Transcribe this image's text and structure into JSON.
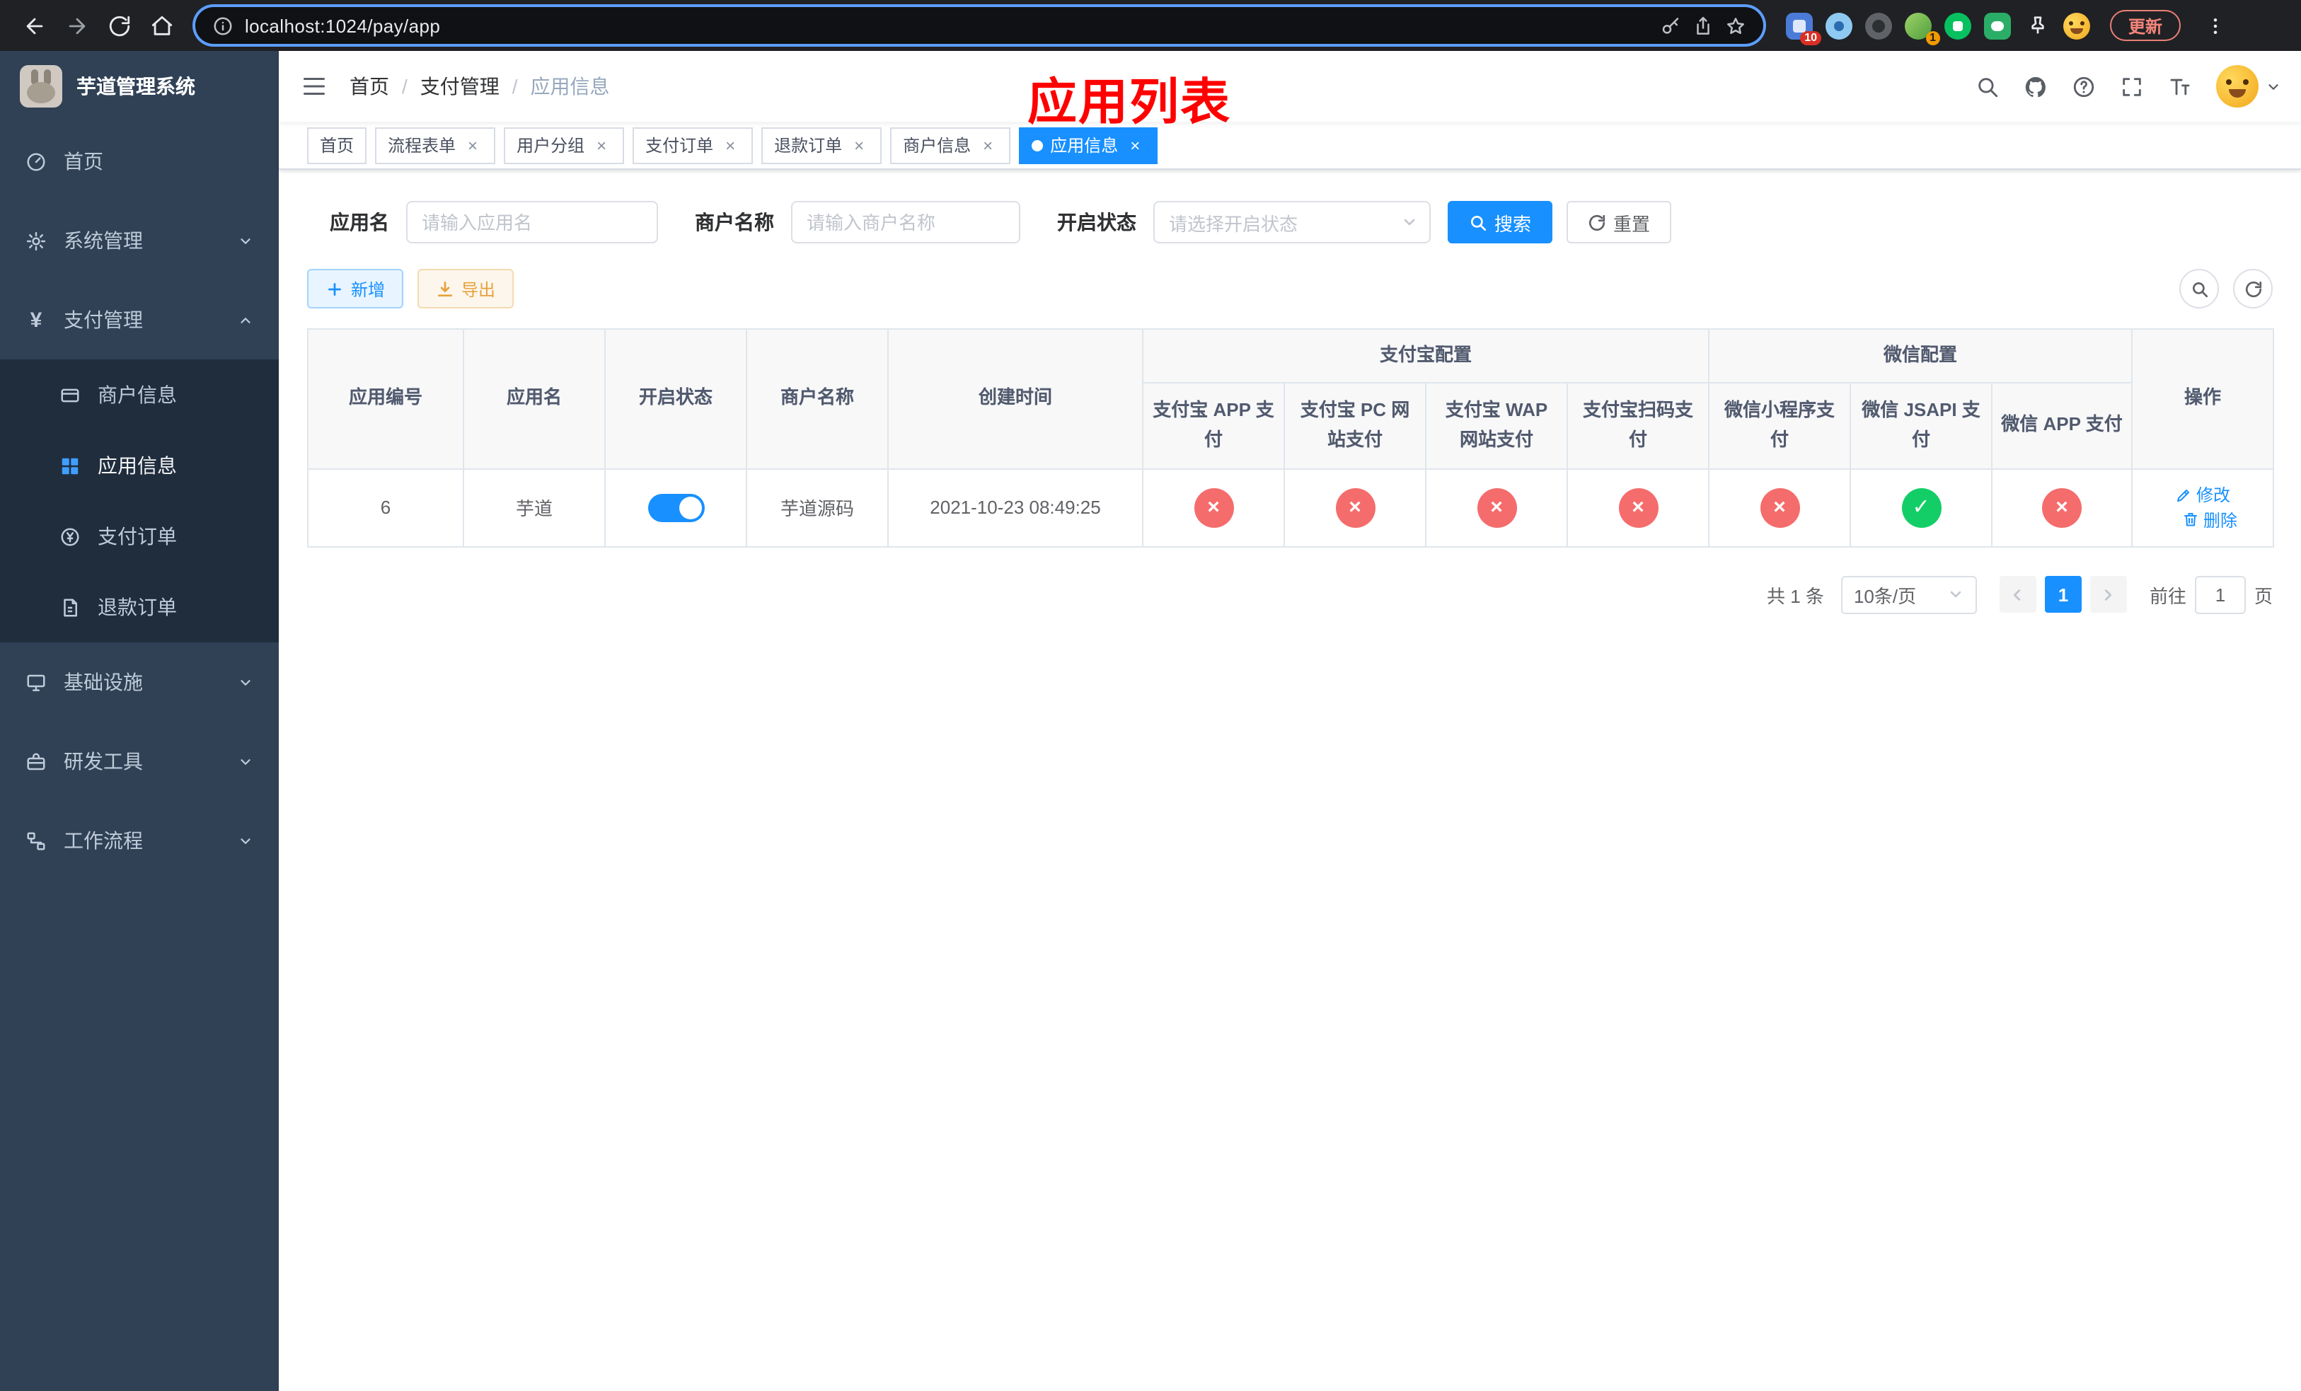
{
  "colors": {
    "primary": "#1890ff",
    "danger": "#f56c6c",
    "success": "#13ce66",
    "sidebar_bg": "#304156",
    "annotation": "#ff0000"
  },
  "browser": {
    "url": "localhost:1024/pay/app",
    "update_label": "更新",
    "extension_badge_puzzle": "10",
    "extension_badge_avatar": "1"
  },
  "sidebar": {
    "app_title": "芋道管理系统",
    "menu": {
      "home": "首页",
      "system": "系统管理",
      "payment": "支付管理",
      "infra": "基础设施",
      "devtools": "研发工具",
      "workflow": "工作流程"
    },
    "payment_children": {
      "merchant": "商户信息",
      "app": "应用信息",
      "order": "支付订单",
      "refund": "退款订单"
    }
  },
  "navbar": {
    "breadcrumb": [
      "首页",
      "支付管理",
      "应用信息"
    ],
    "annotation": "应用列表"
  },
  "tabs": [
    {
      "label": "首页"
    },
    {
      "label": "流程表单"
    },
    {
      "label": "用户分组"
    },
    {
      "label": "支付订单"
    },
    {
      "label": "退款订单"
    },
    {
      "label": "商户信息"
    },
    {
      "label": "应用信息"
    }
  ],
  "filters": {
    "app_name_label": "应用名",
    "app_name_placeholder": "请输入应用名",
    "merchant_label": "商户名称",
    "merchant_placeholder": "请输入商户名称",
    "status_label": "开启状态",
    "status_placeholder": "请选择开启状态",
    "search_label": "搜索",
    "reset_label": "重置"
  },
  "toolbar": {
    "add_label": "新增",
    "export_label": "导出"
  },
  "table": {
    "groups": {
      "alipay": "支付宝配置",
      "wechat": "微信配置"
    },
    "columns": [
      "应用编号",
      "应用名",
      "开启状态",
      "商户名称",
      "创建时间",
      "支付宝 APP 支付",
      "支付宝 PC 网站支付",
      "支付宝 WAP 网站支付",
      "支付宝扫码支付",
      "微信小程序支付",
      "微信 JSAPI 支付",
      "微信 APP 支付",
      "操作"
    ],
    "rows": [
      {
        "id": "6",
        "name": "芋道",
        "enabled": true,
        "merchant": "芋道源码",
        "created_at": "2021-10-23 08:49:25",
        "statuses": {
          "alipay_app": false,
          "alipay_pc": false,
          "alipay_wap": false,
          "alipay_qr": false,
          "wechat_mini": false,
          "wechat_jsapi": true,
          "wechat_app": false
        },
        "edit_label": "修改",
        "delete_label": "删除"
      }
    ]
  },
  "pagination": {
    "total_label": "共 1 条",
    "page_size_label": "10条/页",
    "current_page": "1",
    "goto_label": "前往",
    "goto_value": "1",
    "goto_unit": "页"
  }
}
